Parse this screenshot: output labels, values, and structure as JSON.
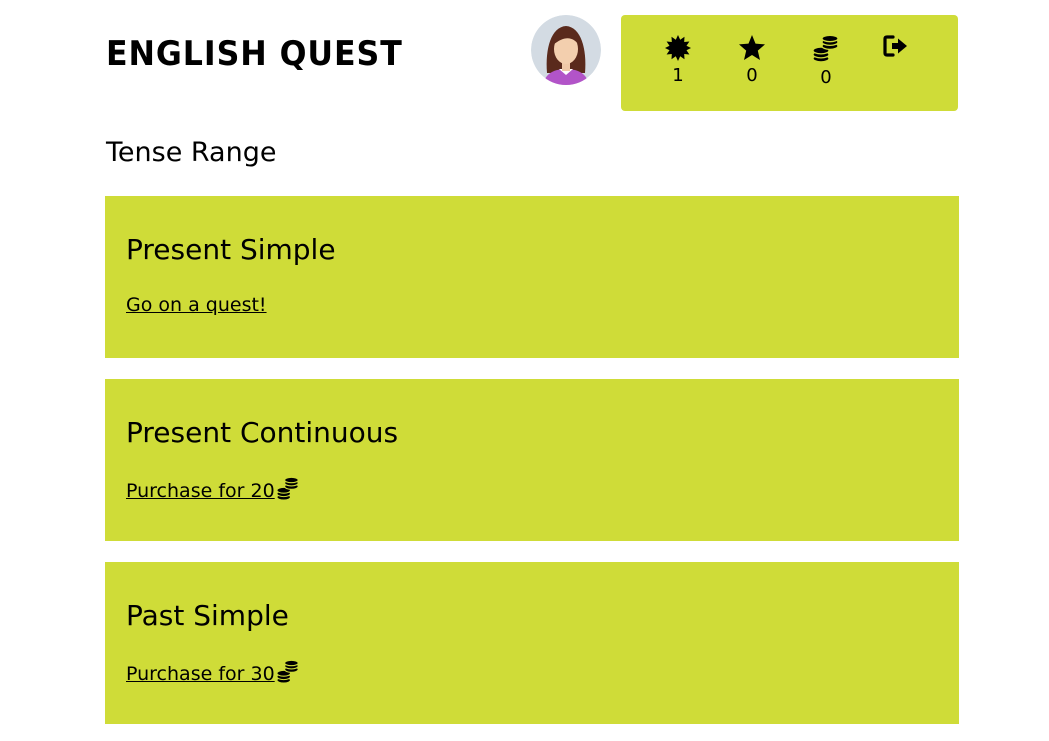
{
  "app": {
    "title": "ENGLISH QUEST"
  },
  "theme": {
    "accent": "#cfdc38"
  },
  "stats": [
    {
      "icon": "badge-icon",
      "value": "1"
    },
    {
      "icon": "star-icon",
      "value": "0"
    },
    {
      "icon": "coins-icon",
      "value": "0"
    },
    {
      "icon": "logout-icon",
      "value": ""
    }
  ],
  "page": {
    "heading": "Tense Range"
  },
  "tenses": [
    {
      "title": "Present Simple",
      "action": "Go on a quest!"
    },
    {
      "title": "Present Continuous",
      "action": "Purchase for 20"
    },
    {
      "title": "Past Simple",
      "action": "Purchase for 30"
    }
  ]
}
